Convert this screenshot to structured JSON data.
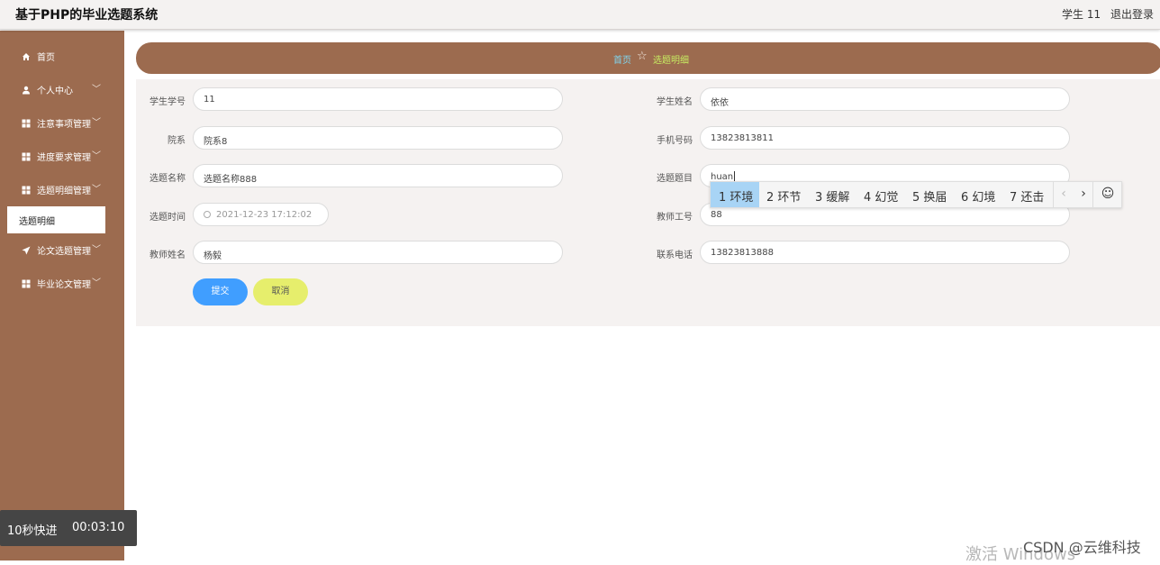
{
  "header": {
    "title": "基于PHP的毕业选题系统",
    "user": "学生 11",
    "logout": "退出登录"
  },
  "sidebar": {
    "items": [
      {
        "label": "首页",
        "icon": "home-icon",
        "chevron": ""
      },
      {
        "label": "个人中心",
        "icon": "user-icon",
        "chevron": "﹀"
      },
      {
        "label": "注意事项管理",
        "icon": "grid-icon",
        "chevron": "﹀"
      },
      {
        "label": "进度要求管理",
        "icon": "grid-icon",
        "chevron": "﹀"
      },
      {
        "label": "选题明细管理",
        "icon": "grid-icon",
        "chevron": "﹀"
      },
      {
        "label": "论文选题管理",
        "icon": "send-icon",
        "chevron": "﹀"
      },
      {
        "label": "毕业论文管理",
        "icon": "grid-icon",
        "chevron": "﹀"
      }
    ],
    "active_sub": "选题明细"
  },
  "breadcrumb": {
    "home": "首页",
    "current": "选题明细"
  },
  "form": {
    "student_no": {
      "label": "学生学号",
      "value": "11"
    },
    "student_name": {
      "label": "学生姓名",
      "value": "依依"
    },
    "department": {
      "label": "院系",
      "value": "院系8"
    },
    "phone": {
      "label": "手机号码",
      "value": "13823813811"
    },
    "topic_name": {
      "label": "选题名称",
      "value": "选题名称888"
    },
    "topic_title": {
      "label": "选题题目",
      "value": "huan"
    },
    "topic_time": {
      "label": "选题时间",
      "value": "2021-12-23 17:12:02"
    },
    "teacher_no": {
      "label": "教师工号",
      "value": "88"
    },
    "teacher_name": {
      "label": "教师姓名",
      "value": "杨毅"
    },
    "contact_phone": {
      "label": "联系电话",
      "value": "13823813888"
    },
    "submit": "提交",
    "cancel": "取消"
  },
  "ime": {
    "candidates": [
      "1 环境",
      "2 环节",
      "3 缓解",
      "4 幻觉",
      "5 换届",
      "6 幻境",
      "7 还击"
    ],
    "prev": "‹",
    "next": "›",
    "emoji": "☺"
  },
  "overlay": {
    "fast_forward": "10秒快进",
    "time": "00:03:10",
    "watermark_csdn": "CSDN @云维科技",
    "watermark_windows": "激活 Windows"
  }
}
